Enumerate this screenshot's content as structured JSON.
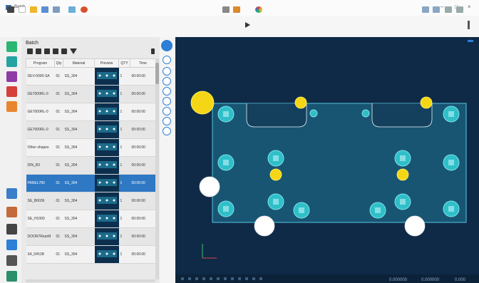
{
  "window": {
    "title": "Batch",
    "controls": [
      "–",
      "□",
      "×"
    ]
  },
  "toolbar": {
    "left_icons": [
      "grid-icon",
      "new-icon",
      "open-icon",
      "save-icon",
      "print-icon",
      "undo-icon",
      "settings-icon"
    ],
    "center_icons": [
      "layout-icon",
      "edit-icon",
      "play-icon",
      "color-icon"
    ],
    "right_icons": [
      "back-icon",
      "forward-icon",
      "zoom-icon",
      "fit-icon",
      "info-icon"
    ]
  },
  "rail": {
    "items": [
      "batch-green-1",
      "batch-green-2",
      "batch-purple",
      "batch-red",
      "batch-orange",
      "home",
      "parts",
      "machine",
      "tools",
      "export",
      "layout"
    ]
  },
  "batch": {
    "title": "Batch",
    "columns": [
      "Program",
      "Qty",
      "Material",
      "Preview",
      "QTY",
      "Time"
    ],
    "rows": [
      {
        "program": "DEV-0000-SA",
        "qty": "01",
        "material": "SS_304",
        "qtyb": "1",
        "time": "00:00:00"
      },
      {
        "program": "GE7000RL-0",
        "qty": "01",
        "material": "SS_304",
        "qtyb": "1",
        "time": "00:00:00"
      },
      {
        "program": "GE7000RL-0",
        "qty": "01",
        "material": "SS_304",
        "qtyb": "1",
        "time": "00:00:00"
      },
      {
        "program": "GE7000RL-0",
        "qty": "01",
        "material": "SS_304",
        "qtyb": "1",
        "time": "00:00:00"
      },
      {
        "program": "Other shapes",
        "qty": "01",
        "material": "SS_304",
        "qtyb": "1",
        "time": "00:00:00"
      },
      {
        "program": "DIN_B3",
        "qty": "01",
        "material": "SS_304",
        "qtyb": "1",
        "time": "00:00:00"
      },
      {
        "program": "PANEL780",
        "qty": "01",
        "material": "SS_304",
        "qtyb": "1",
        "time": "00:00:00",
        "selected": true
      },
      {
        "program": "SE_B6036",
        "qty": "01",
        "material": "SS_304",
        "qtyb": "1",
        "time": "00:00:00"
      },
      {
        "program": "SE_H1000",
        "qty": "01",
        "material": "SS_304",
        "qtyb": "1",
        "time": "00:00:00"
      },
      {
        "program": "DOOR7RearM",
        "qty": "01",
        "material": "SS_304",
        "qtyb": "1",
        "time": "00:00:00"
      },
      {
        "program": "S4_0451B",
        "qty": "01",
        "material": "SS_304",
        "qtyb": "1",
        "time": "00:00:00"
      }
    ]
  },
  "canvas": {
    "background": "#0f2a47",
    "plate_color": "#2ca7c7",
    "status_items": [
      "0.000000",
      "0.000000",
      "0.000"
    ]
  }
}
